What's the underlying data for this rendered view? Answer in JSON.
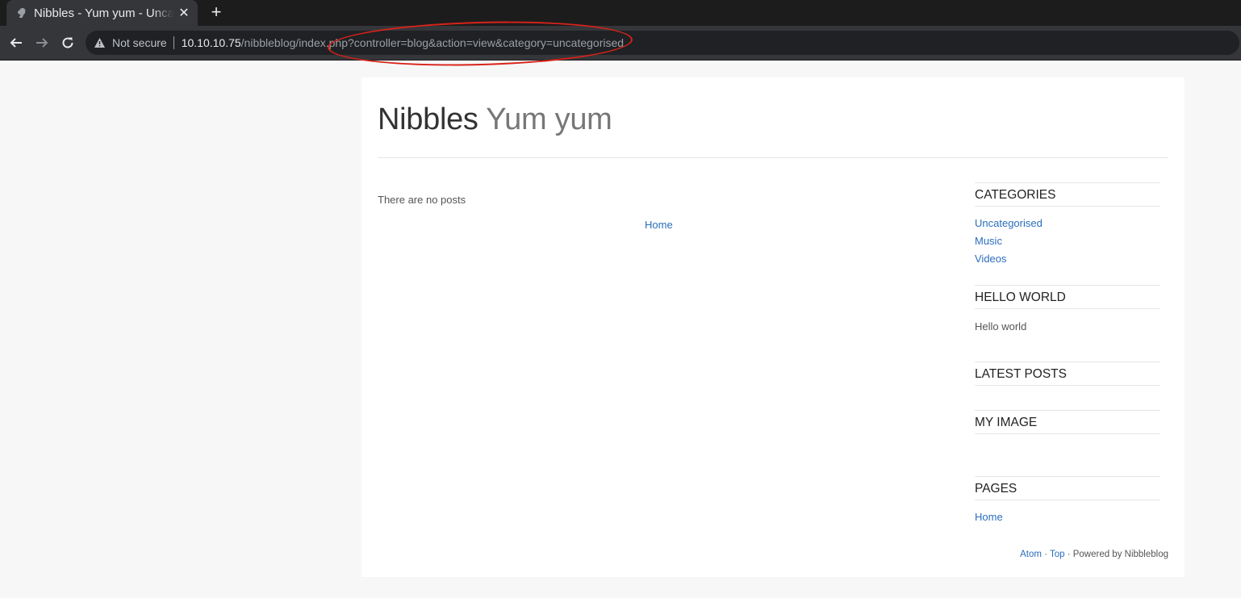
{
  "browser": {
    "tab_title": "Nibbles - Yum yum - Uncategorised",
    "security_label": "Not secure",
    "url_host": "10.10.10.75",
    "url_path": "/nibbleblog/index.php?controller=blog&action=view&category=uncategorised"
  },
  "site": {
    "name": "Nibbles",
    "slogan": "Yum yum"
  },
  "main": {
    "empty_message": "There are no posts",
    "home_link": "Home"
  },
  "sidebar": {
    "categories": {
      "title": "CATEGORIES",
      "items": [
        "Uncategorised",
        "Music",
        "Videos"
      ]
    },
    "hello_world": {
      "title": "HELLO WORLD",
      "text": "Hello world"
    },
    "latest_posts": {
      "title": "LATEST POSTS"
    },
    "my_image": {
      "title": "MY IMAGE"
    },
    "pages": {
      "title": "PAGES",
      "items": [
        "Home"
      ]
    }
  },
  "footer": {
    "atom": "Atom",
    "sep1": " · ",
    "top": "Top",
    "powered": " · Powered by Nibbleblog"
  },
  "colors": {
    "link": "#2a6ebb",
    "annotation": "#d8231a",
    "chrome_dark": "#35363a"
  }
}
